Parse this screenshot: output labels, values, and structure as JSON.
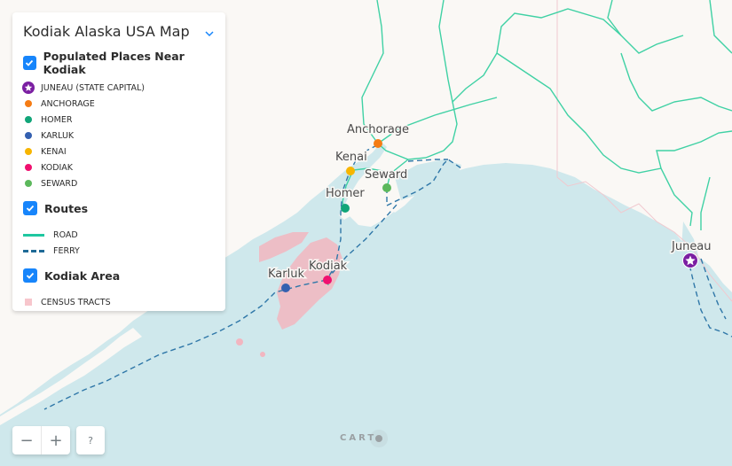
{
  "legend": {
    "title": "Kodiak Alaska USA Map",
    "layers": [
      {
        "title": "Populated Places Near Kodiak",
        "checked": true,
        "items": [
          {
            "label": "JUNEAU (STATE CAPITAL)",
            "symbol": "star-badge",
            "color": "#7b1fa2"
          },
          {
            "label": "ANCHORAGE",
            "symbol": "dot",
            "color": "#f57c14"
          },
          {
            "label": "HOMER",
            "symbol": "dot",
            "color": "#11a579"
          },
          {
            "label": "KARLUK",
            "symbol": "dot",
            "color": "#3460b0"
          },
          {
            "label": "KENAI",
            "symbol": "dot",
            "color": "#f7b500"
          },
          {
            "label": "KODIAK",
            "symbol": "dot",
            "color": "#f0106f"
          },
          {
            "label": "SEWARD",
            "symbol": "dot",
            "color": "#5cb85c"
          }
        ]
      },
      {
        "title": "Routes",
        "checked": true,
        "items": [
          {
            "label": "ROAD",
            "symbol": "solid-line",
            "color": "#1fc7a0"
          },
          {
            "label": "FERRY",
            "symbol": "dashed-line",
            "color": "#1f6a96"
          }
        ]
      },
      {
        "title": "Kodiak Area",
        "checked": true,
        "items": [
          {
            "label": "CENSUS TRACTS",
            "symbol": "square",
            "color": "#f7c6cc"
          }
        ]
      }
    ]
  },
  "map": {
    "colors": {
      "water": "#cfe8ec",
      "land": "#faf8f5",
      "road": "#3fd1a4",
      "ferry": "#2f77a8",
      "census": "#f2b6c0",
      "border": "#f0c9cf"
    },
    "places": [
      {
        "name": "Anchorage",
        "type": "city",
        "color": "#f57c14"
      },
      {
        "name": "Kenai",
        "type": "city",
        "color": "#f7b500"
      },
      {
        "name": "Seward",
        "type": "city",
        "color": "#5cb85c"
      },
      {
        "name": "Homer",
        "type": "city",
        "color": "#11a579"
      },
      {
        "name": "Karluk",
        "type": "city",
        "color": "#3460b0"
      },
      {
        "name": "Kodiak",
        "type": "city",
        "color": "#f0106f"
      },
      {
        "name": "Juneau",
        "type": "capital",
        "color": "#7b1fa2"
      }
    ]
  },
  "controls": {
    "zoom_out": "−",
    "zoom_in": "+",
    "help": "?"
  },
  "attribution": {
    "logo_text": "CARTO"
  }
}
